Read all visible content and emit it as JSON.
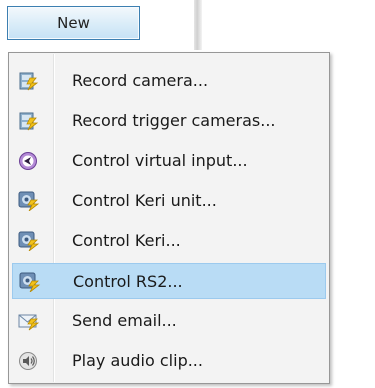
{
  "toolbar": {
    "new_label": "New"
  },
  "menu": {
    "items": [
      {
        "label": "Record camera...",
        "icon": "record-camera-icon"
      },
      {
        "label": "Record trigger cameras...",
        "icon": "record-trigger-cameras-icon"
      },
      {
        "label": "Control virtual input...",
        "icon": "virtual-input-icon"
      },
      {
        "label": "Control Keri unit...",
        "icon": "keri-unit-icon"
      },
      {
        "label": "Control Keri...",
        "icon": "keri-icon"
      },
      {
        "label": "Control RS2...",
        "icon": "rs2-icon",
        "selected": true
      },
      {
        "label": "Send email...",
        "icon": "email-icon"
      },
      {
        "label": "Play audio clip...",
        "icon": "audio-clip-icon"
      }
    ]
  },
  "colors": {
    "selection": "#b9dcf5",
    "menu_background": "#f3f3f3",
    "button_border": "#3c7fb1"
  }
}
